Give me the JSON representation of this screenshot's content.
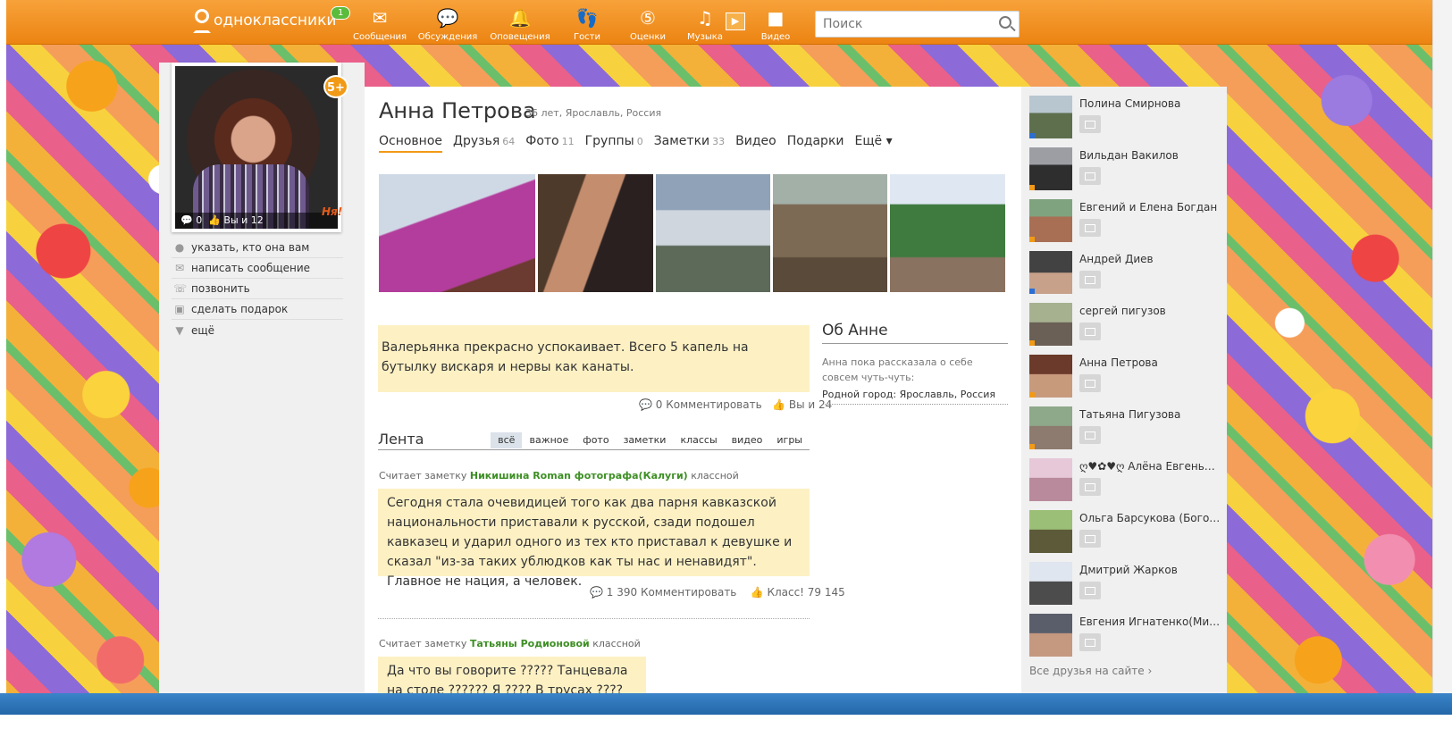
{
  "topbar": {
    "logo_text": "одноклассники",
    "logo_badge": "1",
    "nav": [
      {
        "label": "Сообщения",
        "icon": "envelope-icon"
      },
      {
        "label": "Обсуждения",
        "icon": "speech-bubbles-icon"
      },
      {
        "label": "Оповещения",
        "icon": "bell-icon"
      },
      {
        "label": "Гости",
        "icon": "footprints-icon"
      },
      {
        "label": "Оценки",
        "icon": "five-star-icon"
      },
      {
        "label": "Музыка",
        "icon": "music-note-icon"
      },
      {
        "label": "Видео",
        "icon": "video-camera-icon"
      }
    ],
    "search_placeholder": "Поиск"
  },
  "profile": {
    "name": "Анна Петрова",
    "info": "36 лет, Ярославль, Россия",
    "avatar_comments": "0",
    "avatar_likes": "Вы и 12",
    "badge": "5+",
    "sticker_text": "Ня!",
    "left_menu": [
      {
        "label": "указать, кто она вам",
        "icon": "pin-icon"
      },
      {
        "label": "написать сообщение",
        "icon": "envelope-icon"
      },
      {
        "label": "позвонить",
        "icon": "phone-icon"
      },
      {
        "label": "сделать подарок",
        "icon": "gift-icon"
      },
      {
        "label": "ещё",
        "icon": "chevron-down-icon"
      }
    ],
    "tabs": [
      {
        "label": "Основное",
        "count": ""
      },
      {
        "label": "Друзья",
        "count": "64"
      },
      {
        "label": "Фото",
        "count": "11"
      },
      {
        "label": "Группы",
        "count": "0"
      },
      {
        "label": "Заметки",
        "count": "33"
      },
      {
        "label": "Видео",
        "count": ""
      },
      {
        "label": "Подарки",
        "count": ""
      },
      {
        "label": "Ещё ▾",
        "count": ""
      }
    ]
  },
  "status": {
    "text": "Валерьянка прекрасно успокаивает. Всего 5 капель на бутылку вискаря и нервы как канаты.",
    "comments": "0 Комментировать",
    "likes": "Вы и 24"
  },
  "about": {
    "title": "Об Анне",
    "text": "Анна пока рассказала о себе совсем чуть-чуть:",
    "town": "Родной город: Ярославль, Россия"
  },
  "feed": {
    "title": "Лента",
    "tabs": [
      "всё",
      "важное",
      "фото",
      "заметки",
      "классы",
      "видео",
      "игры"
    ],
    "posts": [
      {
        "byline_pre": "Считает заметку ",
        "byline_author": "Никишина Roman фотографа(Калуги)",
        "byline_post": " классной",
        "text": "Сегодня стала очевидицей того как два парня кавказской национальности приставали к русской, сзади подошел кавказец и ударил одного из тех кто приставал к девушке и сказал \"из-за таких ублюдков как ты нас и ненавидят\".   Главное не нация, а  человек.",
        "comments": "1 390 Комментировать",
        "likes": "Класс! 79 145"
      },
      {
        "byline_pre": "Считает заметку ",
        "byline_author": "Татьяны Родионовой",
        "byline_post": " классной",
        "text": "Да что вы говорите ????? Танцевала на столе ?????? Я ???? В трусах ???? Да вы рано"
      }
    ]
  },
  "friends": {
    "items": [
      {
        "name": "Полина Смирнова",
        "status": "#2a6ed6"
      },
      {
        "name": "Вильдан Вакилов",
        "status": "#f29a16"
      },
      {
        "name": "Евгений и Елена Богдан",
        "status": "#f29a16"
      },
      {
        "name": "Андрей Диев",
        "status": "#2a6ed6"
      },
      {
        "name": "сергей пигузов",
        "status": "#f29a16"
      },
      {
        "name": "Анна Петрова",
        "status": "#f29a16"
      },
      {
        "name": "Татьяна Пигузова",
        "status": "#f29a16"
      },
      {
        "name": "ღ♥✿♥ღ Алёна Евгеньевна...",
        "status": ""
      },
      {
        "name": "Ольга Барсукова (Богомо...",
        "status": ""
      },
      {
        "name": "Дмитрий Жарков",
        "status": ""
      },
      {
        "name": "Евгения Игнатенко(Михай...",
        "status": ""
      }
    ],
    "all_link": "Все друзья на сайте ›"
  },
  "colors": {
    "brand": "#f29a16",
    "link_green": "#3d8f24",
    "note_bg": "#fdf1c4"
  }
}
